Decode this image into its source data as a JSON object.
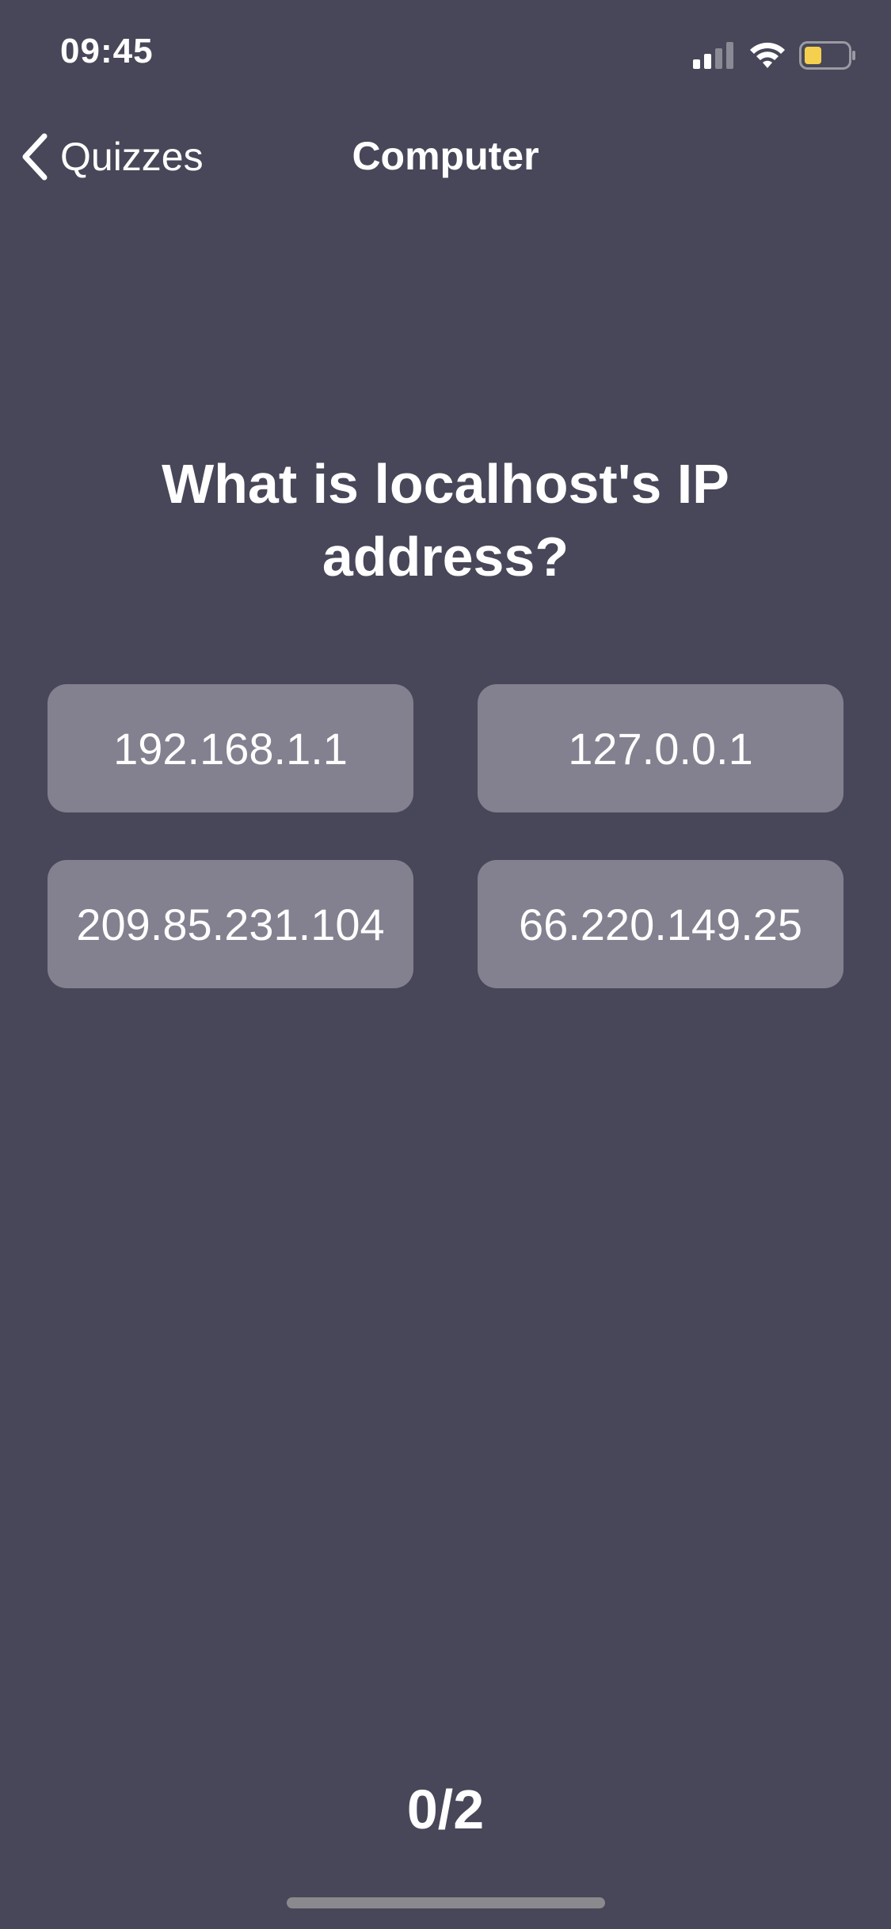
{
  "status_bar": {
    "time": "09:45",
    "signal_icon": "cellular-signal-icon",
    "wifi_icon": "wifi-icon",
    "battery_icon": "battery-icon",
    "battery_level": 0.4,
    "battery_color": "#f5d04f"
  },
  "nav": {
    "back_label": "Quizzes",
    "title": "Computer"
  },
  "question": {
    "text": "What is localhost's IP address?"
  },
  "answers": [
    {
      "label": "192.168.1.1"
    },
    {
      "label": "127.0.0.1"
    },
    {
      "label": "209.85.231.104"
    },
    {
      "label": "66.220.149.25"
    }
  ],
  "score": {
    "text": "0/2"
  },
  "colors": {
    "background": "#484759",
    "answer_tile": "#83818f",
    "text": "#ffffff"
  }
}
